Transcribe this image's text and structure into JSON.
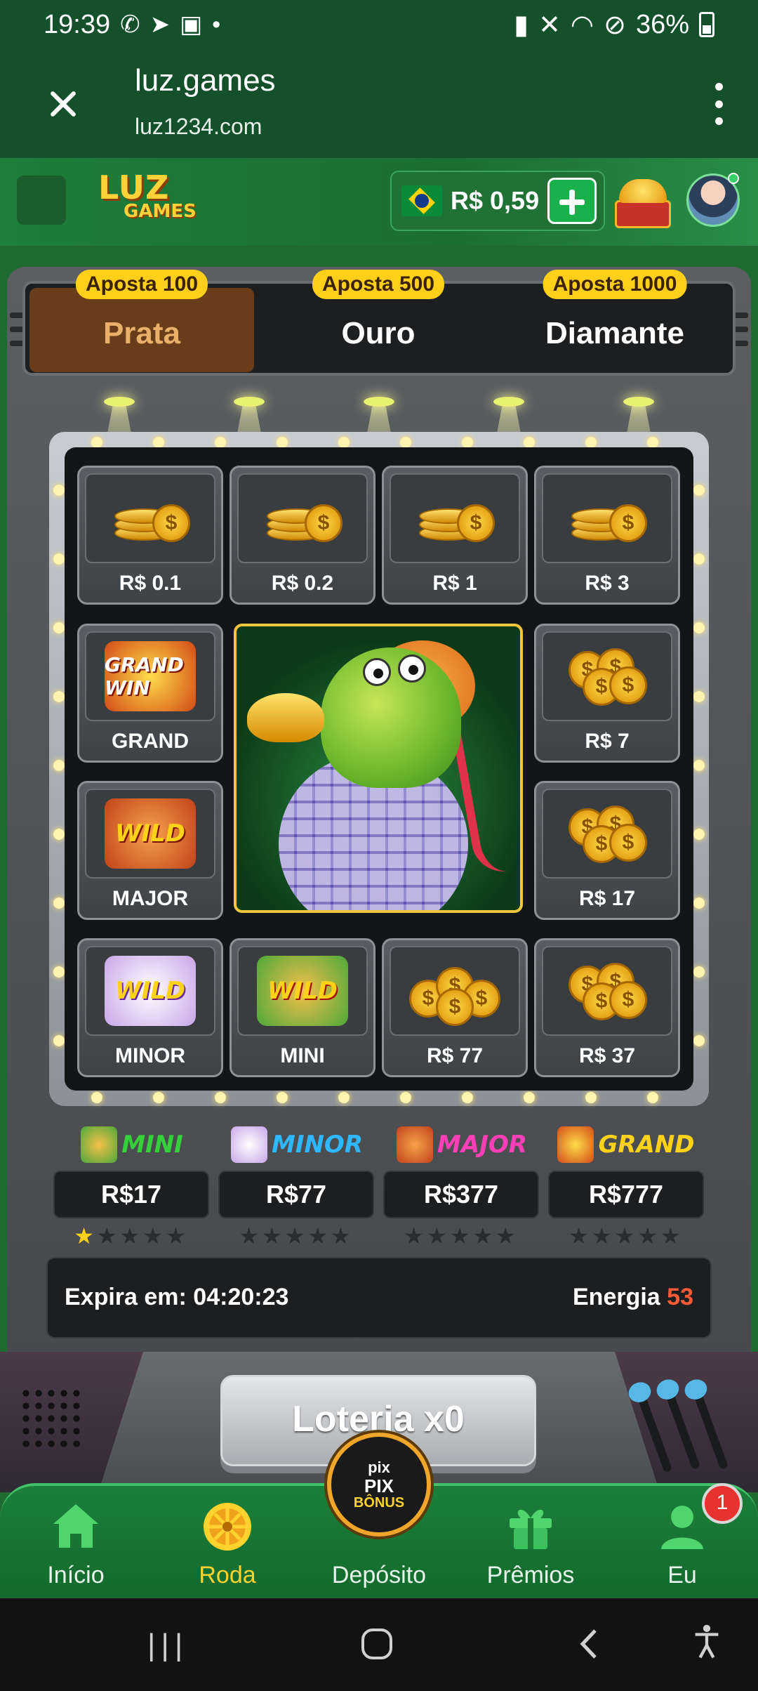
{
  "status_bar": {
    "time": "19:39",
    "battery": "36%"
  },
  "browser": {
    "title": "luz.games",
    "url": "luz1234.com"
  },
  "header": {
    "logo_line1": "LUZ",
    "logo_line2": "GAMES",
    "balance": "R$ 0,59"
  },
  "tabs": [
    {
      "badge": "Aposta 100",
      "label": "Prata",
      "active": true
    },
    {
      "badge": "Aposta 500",
      "label": "Ouro",
      "active": false
    },
    {
      "badge": "Aposta 1000",
      "label": "Diamante",
      "active": false
    }
  ],
  "grid": {
    "row1": [
      "R$ 0.1",
      "R$ 0.2",
      "R$ 1",
      "R$ 3"
    ],
    "grand_label": "GRAND",
    "grand_emblem": "GRAND WIN",
    "major_label": "MAJOR",
    "r7": "R$ 7",
    "r17": "R$ 17",
    "row4": [
      "MINOR",
      "MINI",
      "R$ 77",
      "R$ 37"
    ],
    "wild_text": "WILD"
  },
  "jackpots": [
    {
      "name": "MINI",
      "value": "R$17",
      "stars_on": 1,
      "color": "#35d13a"
    },
    {
      "name": "MINOR",
      "value": "R$77",
      "stars_on": 0,
      "color": "#2fb7ff"
    },
    {
      "name": "MAJOR",
      "value": "R$377",
      "stars_on": 0,
      "color": "#ff3fb8"
    },
    {
      "name": "GRAND",
      "value": "R$777",
      "stars_on": 0,
      "color": "#ffd21a"
    }
  ],
  "info": {
    "expire": "Expira em: 04:20:23",
    "energy_label": "Energia",
    "energy_value": "53"
  },
  "lottery_button": "Loteria x0",
  "pix_button": {
    "line1": "pix",
    "line2": "PIX",
    "line3": "BÔNUS"
  },
  "nav": [
    {
      "label": "Início",
      "icon": "home-icon"
    },
    {
      "label": "Roda",
      "icon": "wheel-icon",
      "active": true
    },
    {
      "label": "Depósito",
      "icon": "pix-icon"
    },
    {
      "label": "Prêmios",
      "icon": "gift-icon"
    },
    {
      "label": "Eu",
      "icon": "user-icon"
    }
  ],
  "notification_count": "1"
}
